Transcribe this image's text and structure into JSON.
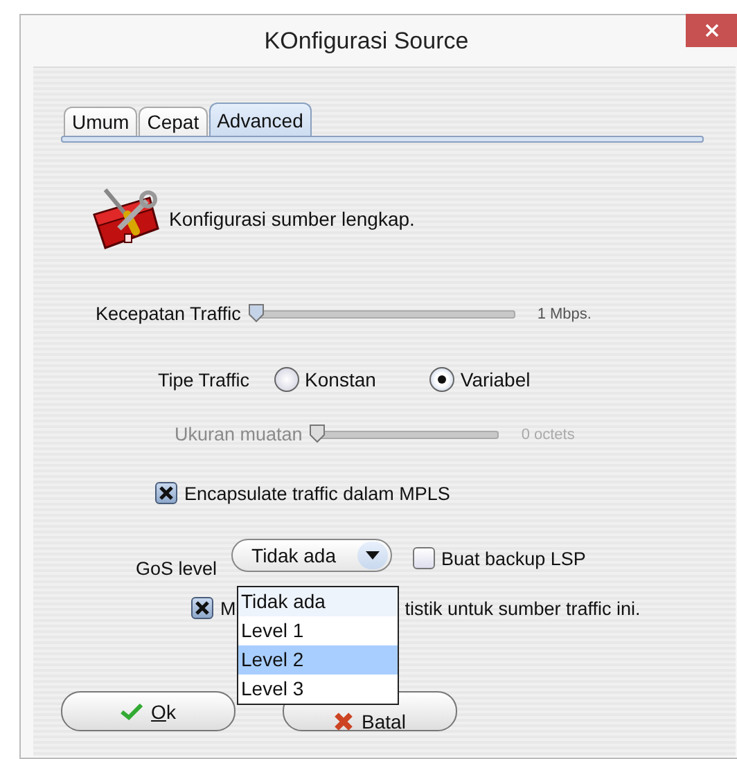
{
  "window": {
    "title": "KOnfigurasi Source"
  },
  "tabs": [
    {
      "label": "Umum",
      "selected": false
    },
    {
      "label": "Cepat",
      "selected": false
    },
    {
      "label": "Advanced",
      "selected": true
    }
  ],
  "header": {
    "text": "Konfigurasi sumber lengkap."
  },
  "speed": {
    "label": "Kecepatan Traffic",
    "level": 0,
    "reading": "1 Mbps.",
    "disabled": false
  },
  "traffic_type": {
    "label": "Tipe Traffic",
    "options": [
      {
        "label": "Konstan",
        "selected": false
      },
      {
        "label": "Variabel",
        "selected": true
      }
    ]
  },
  "payload": {
    "label": "Ukuran muatan",
    "level": 0,
    "reading": "0 octets",
    "disabled": true
  },
  "encapsulate": {
    "label": "Encapsulate traffic dalam MPLS",
    "checked": true
  },
  "gos": {
    "label": "GoS level",
    "value": "Tidak ada",
    "expanded": true,
    "options": [
      {
        "label": "Tidak ada",
        "selected": true,
        "highlighted": false
      },
      {
        "label": "Level 1",
        "selected": false,
        "highlighted": false
      },
      {
        "label": "Level 2",
        "selected": false,
        "highlighted": true
      },
      {
        "label": "Level 3",
        "selected": false,
        "highlighted": false
      }
    ]
  },
  "backup_lsp": {
    "label": "Buat backup LSP",
    "checked": false
  },
  "statistics": {
    "checked": true,
    "label_start": "M",
    "label_end": "tistik untuk sumber traffic ini."
  },
  "buttons": [
    {
      "label": "Ok",
      "kind": "ok"
    },
    {
      "label": "Batal",
      "kind": "cancel"
    }
  ]
}
